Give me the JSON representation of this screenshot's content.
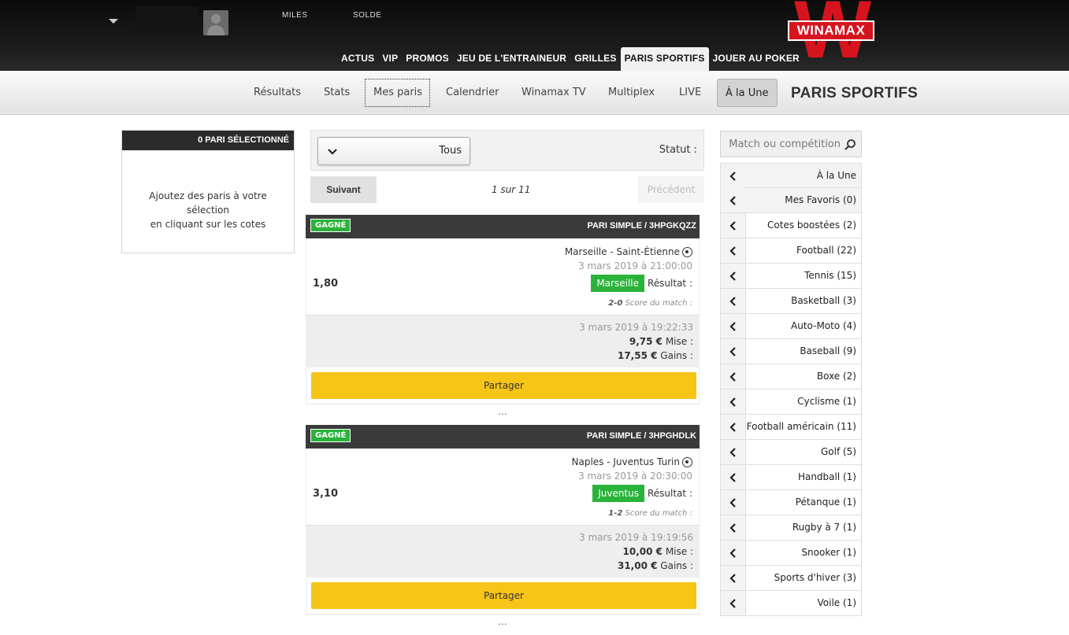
{
  "header": {
    "top_links": {
      "miles": "MILES",
      "solde": "SOLDE"
    },
    "logo_text": "WINAMAX",
    "logo_letter": "W",
    "main_nav": [
      {
        "label": "ACTUS",
        "active": false
      },
      {
        "label": "VIP",
        "active": false
      },
      {
        "label": "PROMOS",
        "active": false
      },
      {
        "label": "JEU DE L'ENTRAINEUR",
        "active": false
      },
      {
        "label": "GRILLES",
        "active": false
      },
      {
        "label": "PARIS SPORTIFS",
        "active": true
      },
      {
        "label": "JOUER AU POKER",
        "active": false
      }
    ]
  },
  "subnav": {
    "title": "PARIS SPORTIFS",
    "items": [
      {
        "label": "Résultats"
      },
      {
        "label": "Stats"
      },
      {
        "label": "Mes paris"
      },
      {
        "label": "Calendrier"
      },
      {
        "label": "Winamax TV"
      },
      {
        "label": "Multiplex"
      },
      {
        "label": "LIVE"
      },
      {
        "label": "À la Une"
      }
    ]
  },
  "betslip": {
    "header": "0 PARI SÉLECTIONNÉ",
    "message_line1": "Ajoutez des paris à votre sélection",
    "message_line2": "en cliquant sur les cotes"
  },
  "filter": {
    "label": "Statut :",
    "selected": "Tous"
  },
  "pager": {
    "next": "Suivant",
    "count": "1 sur 11",
    "prev": "Précédent"
  },
  "bets": [
    {
      "title": "PARI SIMPLE / 3HPGKQZZ",
      "status": "GAGNÉ",
      "match": "Marseille - Saint-Étienne",
      "date": "3 mars 2019 à 21:00:00",
      "result_label": "Résultat :",
      "result": "Marseille",
      "odds": "1,80",
      "score_label": "Score du match :",
      "score": "2-0",
      "timestamp": "3 mars 2019 à 19:22:33",
      "mise_label": "Mise :",
      "mise": "9,75 €",
      "gains_label": "Gains :",
      "gains": "17,55 €",
      "share": "Partager",
      "more": "..."
    },
    {
      "title": "PARI SIMPLE / 3HPGHDLK",
      "status": "GAGNÉ",
      "match": "Naples - Juventus Turin",
      "date": "3 mars 2019 à 20:30:00",
      "result_label": "Résultat :",
      "result": "Juventus",
      "odds": "3,10",
      "score_label": "Score du match :",
      "score": "1-2",
      "timestamp": "3 mars 2019 à 19:19:56",
      "mise_label": "Mise :",
      "mise": "10,00 €",
      "gains_label": "Gains :",
      "gains": "31,00 €",
      "share": "Partager",
      "more": "..."
    }
  ],
  "sidebar": {
    "search_placeholder": "Match ou compétition",
    "items": [
      {
        "label": "À la Une"
      },
      {
        "label": "Mes Favoris (0)"
      },
      {
        "label": "Cotes boostées (2)"
      },
      {
        "label": "Football (22)"
      },
      {
        "label": "Tennis (15)"
      },
      {
        "label": "Basketball (3)"
      },
      {
        "label": "Auto-Moto (4)"
      },
      {
        "label": "Baseball (9)"
      },
      {
        "label": "Boxe (2)"
      },
      {
        "label": "Cyclisme (1)"
      },
      {
        "label": "Football américain (11)"
      },
      {
        "label": "Golf (5)"
      },
      {
        "label": "Handball (1)"
      },
      {
        "label": "Pétanque (1)"
      },
      {
        "label": "Rugby à 7 (1)"
      },
      {
        "label": "Snooker (1)"
      },
      {
        "label": "Sports d'hiver (3)"
      },
      {
        "label": "Voile (1)"
      }
    ]
  }
}
